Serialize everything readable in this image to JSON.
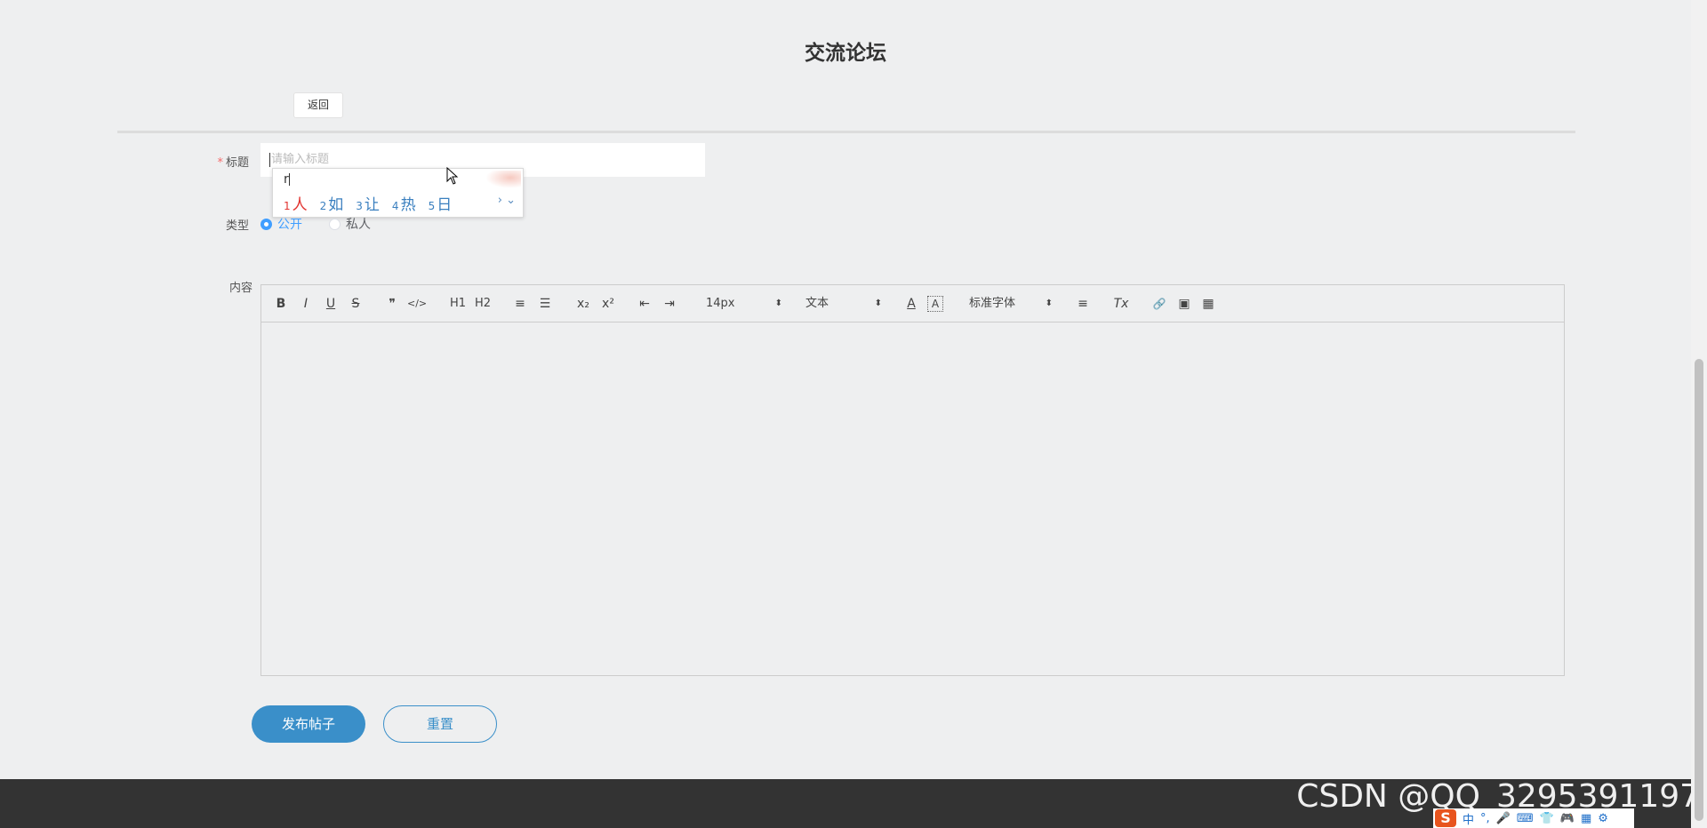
{
  "page": {
    "title": "交流论坛",
    "back_label": "返回"
  },
  "form": {
    "title_label": "标题",
    "required_mark": "*",
    "title_placeholder": "请输入标题",
    "type_label": "类型",
    "type_options": [
      {
        "label": "公开",
        "selected": true
      },
      {
        "label": "私人",
        "selected": false
      }
    ],
    "content_label": "内容"
  },
  "ime_popup": {
    "pinyin": "r",
    "candidates": [
      {
        "num": "1",
        "text": "人"
      },
      {
        "num": "2",
        "text": "如"
      },
      {
        "num": "3",
        "text": "让"
      },
      {
        "num": "4",
        "text": "热"
      },
      {
        "num": "5",
        "text": "日"
      }
    ],
    "next": "›",
    "expand": "⌄"
  },
  "editor": {
    "toolbar": {
      "bold": "B",
      "italic": "I",
      "underline": "U",
      "strike": "S",
      "quote": "❞",
      "code": "</>",
      "h1": "H1",
      "h2": "H2",
      "ordered_list": "≡",
      "bullet_list": "☰",
      "sub": "x₂",
      "sup": "x²",
      "outdent": "⇤",
      "indent": "⇥",
      "size": "14px",
      "header": "文本",
      "color": "A",
      "background": "A",
      "font": "标准字体",
      "align": "≡",
      "clean": "Tx",
      "link": "🔗",
      "image": "▣",
      "video": "▦"
    }
  },
  "buttons": {
    "submit": "发布帖子",
    "reset": "重置"
  },
  "watermark": "CSDN @QQ_3295391197",
  "tray": {
    "logo": "S",
    "items": [
      "中",
      "°,",
      "🎤",
      "⌨",
      "👕",
      "🎮",
      "▦",
      "⚙"
    ]
  },
  "colors": {
    "primary": "#3a8fc9",
    "radio": "#409eff",
    "footer": "#333333",
    "required": "#f56c6c"
  }
}
